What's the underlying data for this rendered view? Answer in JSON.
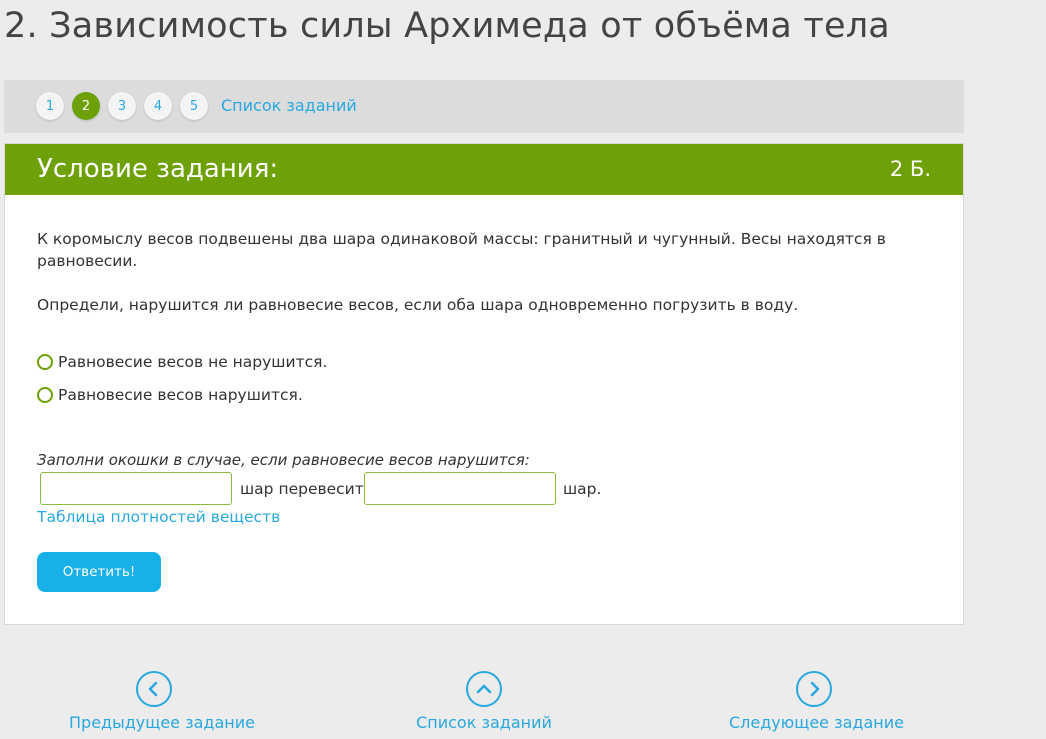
{
  "page": {
    "title": "2. Зависимость силы Архимеда от объёма тела"
  },
  "pager": {
    "numbers": [
      "1",
      "2",
      "3",
      "4",
      "5"
    ],
    "active": "2",
    "list_link": "Список заданий"
  },
  "task": {
    "header_title": "Условие задания:",
    "score": "2 Б.",
    "paragraph1": "К коромыслу весов подвешены два шара одинаковой массы: гранитный и чугунный. Весы находятся в равновесии.",
    "paragraph2": "Определи, нарушится ли равновесие весов, если оба шара одновременно погрузить в воду.",
    "options": [
      {
        "label": "Равновесие весов не нарушится."
      },
      {
        "label": "Равновесие весов нарушится."
      }
    ],
    "hint": "Заполни окошки в случае, если равновесие весов нарушится:",
    "input1_value": "",
    "between_text": "шар перевесит",
    "input2_value": "",
    "after_text": "шар.",
    "density_link": "Таблица плотностей веществ",
    "submit_label": "Ответить!"
  },
  "nav": {
    "prev_label": "Предыдущее задание",
    "list_label": "Список заданий",
    "next_label": "Следующее задание"
  },
  "colors": {
    "green": "#6ea007",
    "blue": "#29a8df",
    "button": "#18b0e8"
  },
  "icons": {
    "prev": "chevron-left-circle-icon",
    "list": "chevron-up-circle-icon",
    "next": "chevron-right-circle-icon"
  }
}
